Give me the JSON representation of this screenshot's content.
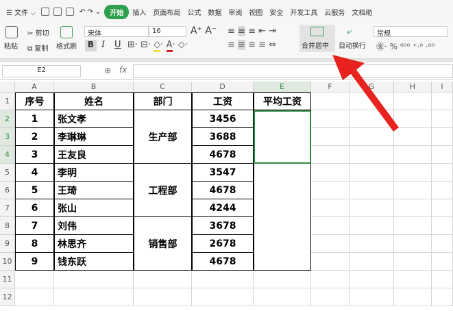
{
  "menubar": {
    "items": [
      "文件",
      "开始",
      "插入",
      "页面布局",
      "公式",
      "数据",
      "审阅",
      "视图",
      "安全",
      "开发工具",
      "云服务",
      "文档助"
    ],
    "active": "开始"
  },
  "ribbon": {
    "paste": "粘贴",
    "cut": "剪切",
    "copy": "复制",
    "format_painter": "格式刷",
    "font": "宋体",
    "size": "16",
    "bold": "B",
    "italic": "I",
    "underline": "U",
    "merge_center": "合并居中",
    "wrap": "自动换行",
    "number_format": "常规",
    "percent": "%"
  },
  "formula": {
    "name_box": "E2",
    "fx": "fx",
    "value": ""
  },
  "columns": [
    "A",
    "B",
    "C",
    "D",
    "E",
    "F",
    "G",
    "H",
    "I"
  ],
  "rows": [
    "1",
    "2",
    "3",
    "4",
    "5",
    "6",
    "7",
    "8",
    "9",
    "10",
    "11",
    "12"
  ],
  "headers": [
    "序号",
    "姓名",
    "部门",
    "工资",
    "平均工资"
  ],
  "data": [
    [
      "1",
      "张文孝",
      "3456"
    ],
    [
      "2",
      "李琳琳",
      "3688"
    ],
    [
      "3",
      "王友良",
      "4678"
    ],
    [
      "4",
      "李明",
      "3547"
    ],
    [
      "5",
      "王琦",
      "4678"
    ],
    [
      "6",
      "张山",
      "4244"
    ],
    [
      "7",
      "刘伟",
      "3678"
    ],
    [
      "8",
      "林思齐",
      "2678"
    ],
    [
      "9",
      "钱东跃",
      "4678"
    ]
  ],
  "departments": [
    "生产部",
    "工程部",
    "销售部"
  ],
  "colors": {
    "accent": "#2ea04d",
    "arrow": "#e8231f"
  }
}
